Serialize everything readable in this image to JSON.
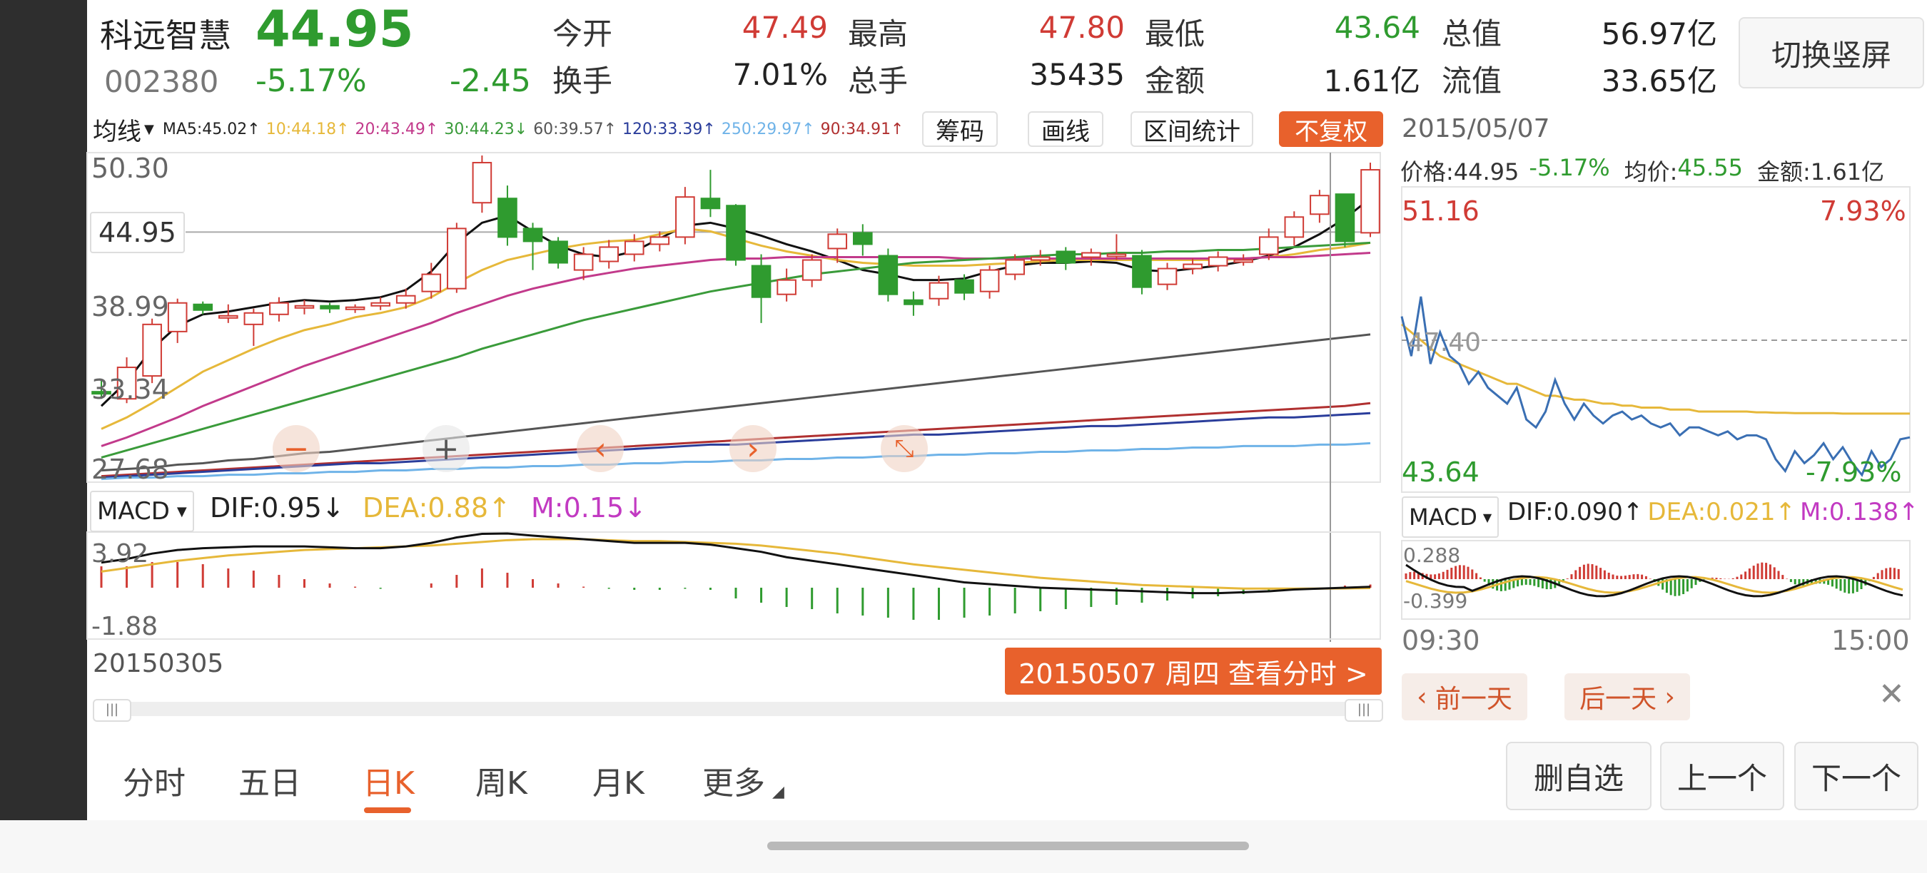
{
  "stock": {
    "name": "科远智慧",
    "price": "44.95",
    "code": "002380",
    "change_pct": "-5.17%",
    "change": "-2.45"
  },
  "stats": [
    {
      "label": "今开",
      "value": "47.49",
      "color": "#d03b35"
    },
    {
      "label": "最高",
      "value": "47.80",
      "color": "#d03b35"
    },
    {
      "label": "最低",
      "value": "43.64",
      "color": "#2f9b2f"
    },
    {
      "label": "总值",
      "value": "56.97亿",
      "color": "#222222"
    },
    {
      "label": "换手",
      "value": "7.01%",
      "color": "#222222"
    },
    {
      "label": "总手",
      "value": "35435",
      "color": "#222222"
    },
    {
      "label": "金额",
      "value": "1.61亿",
      "color": "#222222"
    },
    {
      "label": "流值",
      "value": "33.65亿",
      "color": "#222222"
    }
  ],
  "switch_button": "切换竖屏",
  "indicator": {
    "selector": "均线",
    "ma": [
      {
        "text": "MA5:45.02↑",
        "color": "#222222"
      },
      {
        "text": "10:44.18↑",
        "color": "#e6b83a"
      },
      {
        "text": "20:43.49↑",
        "color": "#c23a8b"
      },
      {
        "text": "30:44.23↓",
        "color": "#3a9b3a"
      },
      {
        "text": "60:39.57↑",
        "color": "#555555"
      },
      {
        "text": "120:33.39↑",
        "color": "#2a3d9b"
      },
      {
        "text": "250:29.97↑",
        "color": "#6fb3e8"
      },
      {
        "text": "90:34.91↑",
        "color": "#b03030"
      }
    ],
    "buttons": [
      "筹码",
      "画线",
      "区间统计"
    ],
    "adjust_button": "不复权"
  },
  "kline": {
    "y_labels": [
      "50.30",
      "44.95",
      "38.99",
      "33.34",
      "27.68"
    ],
    "current_price": "44.95",
    "start_date": "20150305",
    "selected_tag": "20150507 周四 查看分时 >"
  },
  "macd": {
    "selector": "MACD",
    "dif": "DIF:0.95↓",
    "dea": "DEA:0.88↑",
    "m": "M:0.15↓",
    "y_top": "3.92",
    "y_bottom": "-1.88"
  },
  "intraday": {
    "date": "2015/05/07",
    "price": "价格:44.95",
    "pct": "-5.17%",
    "avg_label": "均价:",
    "avg": "45.55",
    "amount": "金额:1.61亿",
    "high": "51.16",
    "high_pct": "7.93%",
    "mid": "47.40",
    "low": "43.64",
    "low_pct": "-7.93%",
    "macd_selector": "MACD",
    "dif": "DIF:0.090↑",
    "dea": "DEA:0.021↑",
    "m": "M:0.138↑",
    "macd_top": "0.288",
    "macd_bottom": "-0.399",
    "time_start": "09:30",
    "time_end": "15:00",
    "prev_day": "前一天",
    "next_day": "后一天"
  },
  "tabs": [
    "分时",
    "五日",
    "日K",
    "周K",
    "月K",
    "更多"
  ],
  "actions": [
    "删自选",
    "上一个",
    "下一个"
  ],
  "chart_data": {
    "type": "candlestick",
    "categories_start": "20150305",
    "categories_end": "20150507",
    "ylim": [
      27.68,
      50.3
    ],
    "candles": [
      {
        "o": 33.8,
        "c": 33.8,
        "h": 34.6,
        "l": 33.3,
        "up": false
      },
      {
        "o": 33.3,
        "c": 35.5,
        "h": 36.2,
        "l": 33.0,
        "up": true
      },
      {
        "o": 34.9,
        "c": 38.5,
        "h": 38.9,
        "l": 34.4,
        "up": true
      },
      {
        "o": 38.0,
        "c": 40.0,
        "h": 40.3,
        "l": 37.2,
        "up": true
      },
      {
        "o": 39.9,
        "c": 39.5,
        "h": 40.1,
        "l": 39.2,
        "up": false
      },
      {
        "o": 39.0,
        "c": 39.1,
        "h": 39.9,
        "l": 38.6,
        "up": true
      },
      {
        "o": 38.5,
        "c": 39.3,
        "h": 39.6,
        "l": 37.0,
        "up": true
      },
      {
        "o": 39.2,
        "c": 40.0,
        "h": 40.4,
        "l": 38.7,
        "up": true
      },
      {
        "o": 39.7,
        "c": 39.8,
        "h": 40.2,
        "l": 39.2,
        "up": true
      },
      {
        "o": 39.8,
        "c": 39.6,
        "h": 40.0,
        "l": 39.3,
        "up": false
      },
      {
        "o": 39.6,
        "c": 39.7,
        "h": 39.9,
        "l": 39.3,
        "up": true
      },
      {
        "o": 39.8,
        "c": 40.0,
        "h": 40.4,
        "l": 39.5,
        "up": true
      },
      {
        "o": 40.0,
        "c": 40.5,
        "h": 41.0,
        "l": 39.6,
        "up": true
      },
      {
        "o": 40.8,
        "c": 42.0,
        "h": 42.8,
        "l": 40.3,
        "up": true
      },
      {
        "o": 41.0,
        "c": 45.2,
        "h": 45.6,
        "l": 40.7,
        "up": true
      },
      {
        "o": 47.0,
        "c": 49.8,
        "h": 50.3,
        "l": 46.3,
        "up": true
      },
      {
        "o": 47.3,
        "c": 44.6,
        "h": 48.2,
        "l": 44.0,
        "up": false
      },
      {
        "o": 45.2,
        "c": 44.3,
        "h": 45.6,
        "l": 42.3,
        "up": false
      },
      {
        "o": 44.3,
        "c": 42.8,
        "h": 44.6,
        "l": 42.4,
        "up": false
      },
      {
        "o": 42.3,
        "c": 43.4,
        "h": 43.9,
        "l": 41.6,
        "up": true
      },
      {
        "o": 42.9,
        "c": 43.9,
        "h": 44.4,
        "l": 42.4,
        "up": true
      },
      {
        "o": 43.4,
        "c": 44.3,
        "h": 44.8,
        "l": 42.9,
        "up": true
      },
      {
        "o": 44.1,
        "c": 44.6,
        "h": 45.0,
        "l": 43.6,
        "up": true
      },
      {
        "o": 44.6,
        "c": 47.4,
        "h": 48.1,
        "l": 44.1,
        "up": true
      },
      {
        "o": 47.3,
        "c": 46.6,
        "h": 49.3,
        "l": 46.0,
        "up": false
      },
      {
        "o": 46.8,
        "c": 43.0,
        "h": 46.9,
        "l": 42.6,
        "up": false
      },
      {
        "o": 42.6,
        "c": 40.4,
        "h": 43.4,
        "l": 38.6,
        "up": false
      },
      {
        "o": 40.6,
        "c": 41.6,
        "h": 42.4,
        "l": 40.1,
        "up": true
      },
      {
        "o": 41.6,
        "c": 43.0,
        "h": 43.4,
        "l": 41.1,
        "up": true
      },
      {
        "o": 43.8,
        "c": 44.8,
        "h": 45.2,
        "l": 42.8,
        "up": true
      },
      {
        "o": 44.9,
        "c": 44.1,
        "h": 45.5,
        "l": 43.3,
        "up": false
      },
      {
        "o": 43.3,
        "c": 40.6,
        "h": 43.8,
        "l": 40.1,
        "up": false
      },
      {
        "o": 40.2,
        "c": 39.9,
        "h": 40.8,
        "l": 39.1,
        "up": false
      },
      {
        "o": 40.3,
        "c": 41.4,
        "h": 41.9,
        "l": 39.8,
        "up": true
      },
      {
        "o": 41.6,
        "c": 40.7,
        "h": 42.0,
        "l": 40.2,
        "up": false
      },
      {
        "o": 40.8,
        "c": 42.3,
        "h": 42.6,
        "l": 40.3,
        "up": true
      },
      {
        "o": 42.0,
        "c": 43.0,
        "h": 43.4,
        "l": 41.6,
        "up": true
      },
      {
        "o": 43.0,
        "c": 43.2,
        "h": 43.7,
        "l": 42.6,
        "up": true
      },
      {
        "o": 43.6,
        "c": 42.8,
        "h": 43.9,
        "l": 42.3,
        "up": false
      },
      {
        "o": 43.2,
        "c": 43.5,
        "h": 43.8,
        "l": 42.6,
        "up": true
      },
      {
        "o": 43.4,
        "c": 43.4,
        "h": 44.8,
        "l": 43.0,
        "up": true
      },
      {
        "o": 43.3,
        "c": 41.1,
        "h": 43.7,
        "l": 40.6,
        "up": false
      },
      {
        "o": 41.3,
        "c": 42.4,
        "h": 42.8,
        "l": 40.9,
        "up": true
      },
      {
        "o": 42.4,
        "c": 42.7,
        "h": 43.1,
        "l": 42.0,
        "up": true
      },
      {
        "o": 42.6,
        "c": 43.2,
        "h": 43.6,
        "l": 42.2,
        "up": true
      },
      {
        "o": 43.0,
        "c": 43.0,
        "h": 43.4,
        "l": 42.6,
        "up": true
      },
      {
        "o": 43.4,
        "c": 44.6,
        "h": 45.2,
        "l": 43.0,
        "up": true
      },
      {
        "o": 44.6,
        "c": 46.0,
        "h": 46.4,
        "l": 44.0,
        "up": true
      },
      {
        "o": 46.2,
        "c": 47.5,
        "h": 47.9,
        "l": 45.6,
        "up": true
      },
      {
        "o": 47.6,
        "c": 44.3,
        "h": 47.6,
        "l": 43.9,
        "up": false
      },
      {
        "o": 44.9,
        "c": 49.3,
        "h": 49.8,
        "l": 44.6,
        "up": true
      }
    ],
    "ma_lines": [
      {
        "name": "MA5",
        "color": "#111111",
        "values": [
          32.8,
          34.5,
          36.8,
          38.4,
          39.2,
          39.4,
          39.7,
          40.0,
          40.2,
          40.1,
          40.2,
          40.4,
          40.9,
          42.2,
          44.2,
          45.6,
          46.1,
          45.0,
          44.0,
          43.4,
          43.2,
          43.6,
          44.5,
          45.4,
          45.6,
          45.2,
          44.7,
          44.1,
          43.6,
          43.0,
          42.3,
          42.0,
          41.6,
          41.6,
          41.7,
          42.2,
          42.6,
          42.8,
          42.8,
          42.9,
          42.8,
          42.3,
          42.2,
          42.4,
          42.6,
          42.9,
          43.3,
          43.9,
          44.8,
          45.9,
          47.3
        ]
      },
      {
        "name": "MA10",
        "color": "#e6b83a",
        "values": [
          31.2,
          32.0,
          33.0,
          34.1,
          35.2,
          36.0,
          36.8,
          37.5,
          38.1,
          38.5,
          39.0,
          39.3,
          39.7,
          40.4,
          41.4,
          42.3,
          43.0,
          43.4,
          43.8,
          44.1,
          44.3,
          44.4,
          44.8,
          45.2,
          45.0,
          44.5,
          44.0,
          43.6,
          43.3,
          43.0,
          42.8,
          42.7,
          42.6,
          42.6,
          42.6,
          42.7,
          42.8,
          42.9,
          43.0,
          43.0,
          43.0,
          43.0,
          43.0,
          43.0,
          43.0,
          43.1,
          43.2,
          43.4,
          43.7,
          43.9,
          44.2
        ]
      },
      {
        "name": "MA20",
        "color": "#c23a8b",
        "values": [
          30.0,
          30.6,
          31.3,
          32.0,
          32.8,
          33.5,
          34.2,
          34.9,
          35.6,
          36.2,
          36.8,
          37.4,
          38.0,
          38.6,
          39.3,
          39.9,
          40.5,
          41.0,
          41.4,
          41.8,
          42.1,
          42.4,
          42.6,
          42.8,
          43.0,
          43.1,
          43.1,
          43.2,
          43.2,
          43.2,
          43.2,
          43.2,
          43.2,
          43.2,
          43.1,
          43.1,
          43.1,
          43.1,
          43.1,
          43.1,
          43.1,
          43.1,
          43.1,
          43.1,
          43.1,
          43.1,
          43.2,
          43.2,
          43.3,
          43.4,
          43.5
        ]
      },
      {
        "name": "MA30",
        "color": "#3a9b3a",
        "values": [
          29.2,
          29.7,
          30.2,
          30.7,
          31.2,
          31.7,
          32.2,
          32.7,
          33.2,
          33.7,
          34.2,
          34.7,
          35.2,
          35.7,
          36.2,
          36.8,
          37.3,
          37.8,
          38.3,
          38.8,
          39.2,
          39.6,
          40.0,
          40.4,
          40.8,
          41.1,
          41.4,
          41.7,
          42.0,
          42.2,
          42.4,
          42.6,
          42.8,
          42.9,
          43.0,
          43.1,
          43.2,
          43.3,
          43.4,
          43.4,
          43.5,
          43.5,
          43.6,
          43.6,
          43.7,
          43.7,
          43.8,
          43.9,
          44.0,
          44.1,
          44.2
        ]
      },
      {
        "name": "MA60",
        "color": "#555555",
        "values": [
          28.3,
          28.4,
          28.5,
          28.7,
          28.8,
          29.0,
          29.1,
          29.3,
          29.5,
          29.6,
          29.8,
          30.0,
          30.2,
          30.4,
          30.6,
          30.8,
          31.0,
          31.2,
          31.4,
          31.6,
          31.8,
          32.0,
          32.2,
          32.4,
          32.6,
          32.8,
          33.0,
          33.2,
          33.4,
          33.6,
          33.8,
          34.0,
          34.2,
          34.4,
          34.6,
          34.8,
          35.0,
          35.2,
          35.4,
          35.6,
          35.8,
          36.0,
          36.2,
          36.4,
          36.6,
          36.8,
          37.0,
          37.2,
          37.4,
          37.6,
          37.8
        ]
      },
      {
        "name": "90",
        "color": "#b03030",
        "values": [
          27.9,
          28.0,
          28.1,
          28.2,
          28.3,
          28.4,
          28.5,
          28.6,
          28.7,
          28.8,
          28.9,
          29.0,
          29.1,
          29.2,
          29.3,
          29.4,
          29.5,
          29.6,
          29.7,
          29.8,
          29.9,
          30.0,
          30.1,
          30.2,
          30.3,
          30.4,
          30.5,
          30.6,
          30.7,
          30.8,
          30.9,
          31.0,
          31.1,
          31.2,
          31.3,
          31.4,
          31.5,
          31.6,
          31.7,
          31.8,
          31.9,
          32.0,
          32.1,
          32.2,
          32.3,
          32.4,
          32.5,
          32.6,
          32.7,
          32.8,
          33.0
        ]
      },
      {
        "name": "120",
        "color": "#2a3d9b",
        "values": [
          27.8,
          27.9,
          28.0,
          28.1,
          28.2,
          28.3,
          28.4,
          28.5,
          28.6,
          28.7,
          28.8,
          28.8,
          28.9,
          29.0,
          29.1,
          29.2,
          29.3,
          29.4,
          29.5,
          29.6,
          29.7,
          29.8,
          29.9,
          30.0,
          30.1,
          30.1,
          30.2,
          30.3,
          30.4,
          30.5,
          30.6,
          30.7,
          30.8,
          30.8,
          30.9,
          31.0,
          31.1,
          31.2,
          31.3,
          31.4,
          31.4,
          31.5,
          31.6,
          31.7,
          31.8,
          31.9,
          32.0,
          32.0,
          32.1,
          32.2,
          32.3
        ]
      },
      {
        "name": "250",
        "color": "#6fb3e8",
        "values": [
          27.7,
          27.8,
          27.8,
          27.9,
          27.9,
          28.0,
          28.0,
          28.1,
          28.1,
          28.2,
          28.2,
          28.3,
          28.3,
          28.4,
          28.4,
          28.5,
          28.5,
          28.6,
          28.6,
          28.7,
          28.7,
          28.8,
          28.8,
          28.9,
          28.9,
          29.0,
          29.0,
          29.1,
          29.1,
          29.2,
          29.2,
          29.3,
          29.3,
          29.4,
          29.4,
          29.5,
          29.5,
          29.6,
          29.6,
          29.7,
          29.7,
          29.8,
          29.8,
          29.9,
          29.9,
          30.0,
          30.0,
          30.0,
          30.1,
          30.1,
          30.2
        ]
      }
    ],
    "macd": {
      "ylim": [
        -1.88,
        3.92
      ],
      "dif": [
        2.3,
        2.5,
        2.8,
        3.0,
        3.1,
        3.15,
        3.2,
        3.2,
        3.2,
        3.15,
        3.1,
        3.1,
        3.2,
        3.4,
        3.7,
        3.9,
        3.92,
        3.8,
        3.7,
        3.6,
        3.5,
        3.4,
        3.4,
        3.4,
        3.3,
        3.1,
        2.9,
        2.6,
        2.4,
        2.2,
        2.0,
        1.8,
        1.6,
        1.4,
        1.2,
        1.1,
        1.0,
        0.9,
        0.85,
        0.8,
        0.75,
        0.7,
        0.65,
        0.6,
        0.6,
        0.65,
        0.7,
        0.8,
        0.85,
        0.9,
        0.95
      ],
      "dea": [
        1.8,
        2.0,
        2.2,
        2.4,
        2.55,
        2.7,
        2.8,
        2.9,
        3.0,
        3.05,
        3.1,
        3.15,
        3.2,
        3.25,
        3.35,
        3.45,
        3.55,
        3.6,
        3.6,
        3.6,
        3.55,
        3.5,
        3.5,
        3.45,
        3.4,
        3.35,
        3.25,
        3.1,
        2.95,
        2.8,
        2.6,
        2.4,
        2.2,
        2.05,
        1.9,
        1.75,
        1.6,
        1.45,
        1.35,
        1.25,
        1.15,
        1.05,
        1.0,
        0.95,
        0.9,
        0.85,
        0.85,
        0.85,
        0.85,
        0.86,
        0.88
      ],
      "hist": [
        1.0,
        1.0,
        1.2,
        1.2,
        1.1,
        0.9,
        0.8,
        0.6,
        0.4,
        0.2,
        0.05,
        -0.05,
        0.0,
        0.2,
        0.6,
        0.9,
        0.7,
        0.4,
        0.2,
        0.05,
        -0.05,
        -0.1,
        -0.1,
        -0.05,
        -0.1,
        -0.5,
        -0.7,
        -0.9,
        -1.0,
        -1.2,
        -1.3,
        -1.4,
        -1.5,
        -1.5,
        -1.4,
        -1.3,
        -1.2,
        -1.1,
        -1.0,
        -0.9,
        -0.8,
        -0.7,
        -0.6,
        -0.5,
        -0.4,
        -0.3,
        -0.2,
        -0.1,
        0.0,
        0.1,
        0.15
      ]
    },
    "intraday": {
      "ylim": [
        43.64,
        51.16
      ],
      "price": [
        48.0,
        47.0,
        48.5,
        46.8,
        47.6,
        47.0,
        46.8,
        46.3,
        46.6,
        46.2,
        46.0,
        45.8,
        46.2,
        45.4,
        45.2,
        45.6,
        46.4,
        45.8,
        45.4,
        45.8,
        45.5,
        45.3,
        45.5,
        45.6,
        45.4,
        45.5,
        45.3,
        45.2,
        45.3,
        45.0,
        45.2,
        45.2,
        45.1,
        45.0,
        45.1,
        44.9,
        45.0,
        45.0,
        44.9,
        44.4,
        44.1,
        44.6,
        44.3,
        44.5,
        44.8,
        44.4,
        44.7,
        44.3,
        44.0,
        44.6,
        44.2,
        44.4,
        44.9,
        44.95
      ],
      "avg": [
        47.8,
        47.6,
        47.4,
        47.2,
        47.0,
        46.9,
        46.8,
        46.7,
        46.6,
        46.5,
        46.4,
        46.3,
        46.3,
        46.2,
        46.1,
        46.0,
        46.0,
        45.95,
        45.9,
        45.9,
        45.85,
        45.8,
        45.8,
        45.75,
        45.75,
        45.7,
        45.7,
        45.7,
        45.65,
        45.65,
        45.65,
        45.6,
        45.6,
        45.6,
        45.6,
        45.6,
        45.6,
        45.58,
        45.58,
        45.57,
        45.57,
        45.56,
        45.56,
        45.56,
        45.56,
        45.56,
        45.55,
        45.55,
        45.55,
        45.55,
        45.55,
        45.55,
        45.55,
        45.55
      ]
    }
  }
}
